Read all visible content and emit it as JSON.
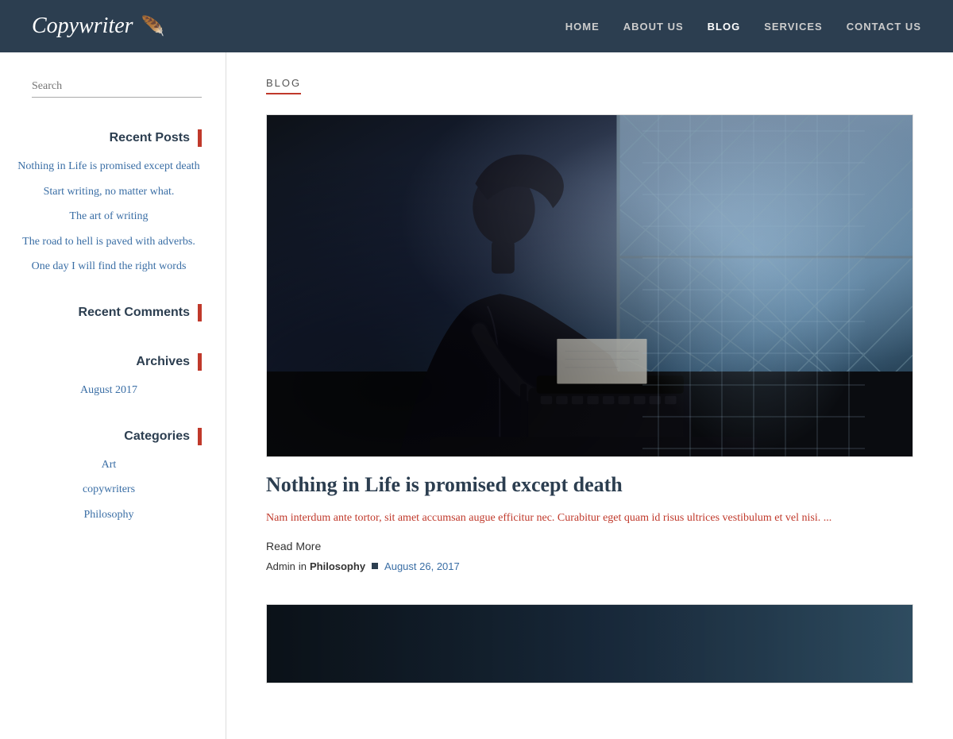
{
  "header": {
    "logo_text": "Copywriter",
    "logo_icon": "🪶",
    "nav": [
      {
        "label": "HOME",
        "href": "#",
        "active": false
      },
      {
        "label": "ABOUT US",
        "href": "#",
        "active": false
      },
      {
        "label": "BLOG",
        "href": "#",
        "active": true
      },
      {
        "label": "SERVICES",
        "href": "#",
        "active": false
      },
      {
        "label": "CONTACT US",
        "href": "#",
        "active": false
      }
    ]
  },
  "sidebar": {
    "search_placeholder": "Search",
    "recent_posts_title": "Recent Posts",
    "recent_posts": [
      {
        "title": "Nothing in Life is promised except death",
        "href": "#"
      },
      {
        "title": "Start writing, no matter what.",
        "href": "#"
      },
      {
        "title": "The art of writing",
        "href": "#"
      },
      {
        "title": "The road to hell is paved with adverbs.",
        "href": "#"
      },
      {
        "title": "One day I will find the right words",
        "href": "#"
      }
    ],
    "recent_comments_title": "Recent Comments",
    "archives_title": "Archives",
    "archive_items": [
      {
        "label": "August 2017",
        "href": "#"
      }
    ],
    "categories_title": "Categories",
    "category_items": [
      {
        "label": "Art",
        "href": "#"
      },
      {
        "label": "copywriters",
        "href": "#"
      },
      {
        "label": "Philosophy",
        "href": "#"
      }
    ]
  },
  "main": {
    "section_label": "BLOG",
    "posts": [
      {
        "title": "Nothing in Life is promised except death",
        "excerpt": "Nam interdum ante tortor, sit amet accumsan augue efficitur nec. Curabitur eget quam id risus ultrices vestibulum et vel nisi. ...",
        "read_more": "Read More",
        "author": "Admin",
        "in_label": "in",
        "category": "Philosophy",
        "date": "August 26, 2017"
      }
    ]
  }
}
